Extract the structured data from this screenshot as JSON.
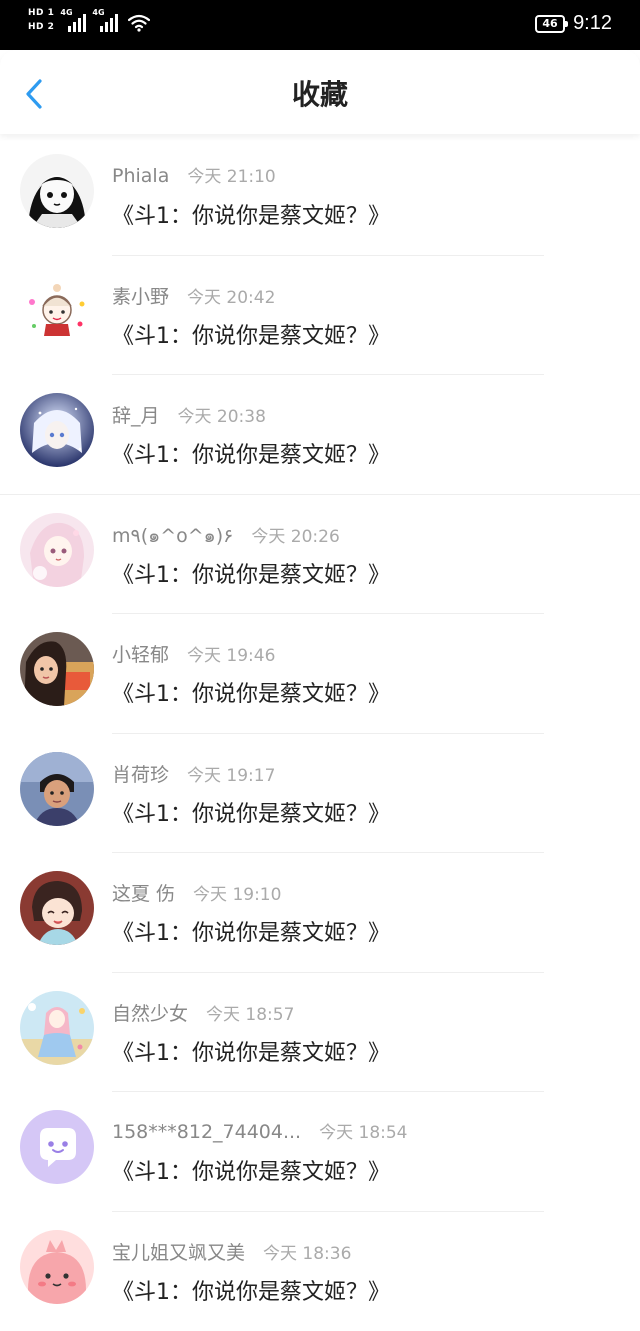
{
  "status_bar": {
    "sim1": "HD 1",
    "sim2": "HD 2",
    "net1": "4G",
    "net2": "4G",
    "battery": "46",
    "time": "9:12"
  },
  "header": {
    "title": "收藏",
    "back_icon": "chevron-left-icon",
    "accent_color": "#2e9bf0"
  },
  "items": [
    {
      "username": "Phiala",
      "time": "今天 21:10",
      "content": "《斗1：你说你是蔡文姬？》",
      "avatar": "avatar-manga-girl"
    },
    {
      "username": "素小野",
      "time": "今天 20:42",
      "content": "《斗1：你说你是蔡文姬？》",
      "avatar": "avatar-chibi-doodle"
    },
    {
      "username": "辞_月",
      "time": "今天 20:38",
      "content": "《斗1：你说你是蔡文姬？》",
      "avatar": "avatar-anime-blue"
    },
    {
      "username": "m٩(๑^o^๑)۶",
      "time": "今天 20:26",
      "content": "《斗1：你说你是蔡文姬？》",
      "avatar": "avatar-anime-pink"
    },
    {
      "username": "小轻郁",
      "time": "今天 19:46",
      "content": "《斗1：你说你是蔡文姬？》",
      "avatar": "avatar-photo-child"
    },
    {
      "username": "肖荷珍",
      "time": "今天 19:17",
      "content": "《斗1：你说你是蔡文姬？》",
      "avatar": "avatar-photo-boy"
    },
    {
      "username": "这夏 伤",
      "time": "今天 19:10",
      "content": "《斗1：你说你是蔡文姬？》",
      "avatar": "avatar-anime-child"
    },
    {
      "username": "自然少女",
      "time": "今天 18:57",
      "content": "《斗1：你说你是蔡文姬？》",
      "avatar": "avatar-anime-pastel"
    },
    {
      "username": "158***812_74404...",
      "time": "今天 18:54",
      "content": "《斗1：你说你是蔡文姬？》",
      "avatar": "avatar-default-chat"
    },
    {
      "username": "宝儿姐又飒又美",
      "time": "今天 18:36",
      "content": "《斗1：你说你是蔡文姬？》",
      "avatar": "avatar-pink-creature"
    }
  ]
}
